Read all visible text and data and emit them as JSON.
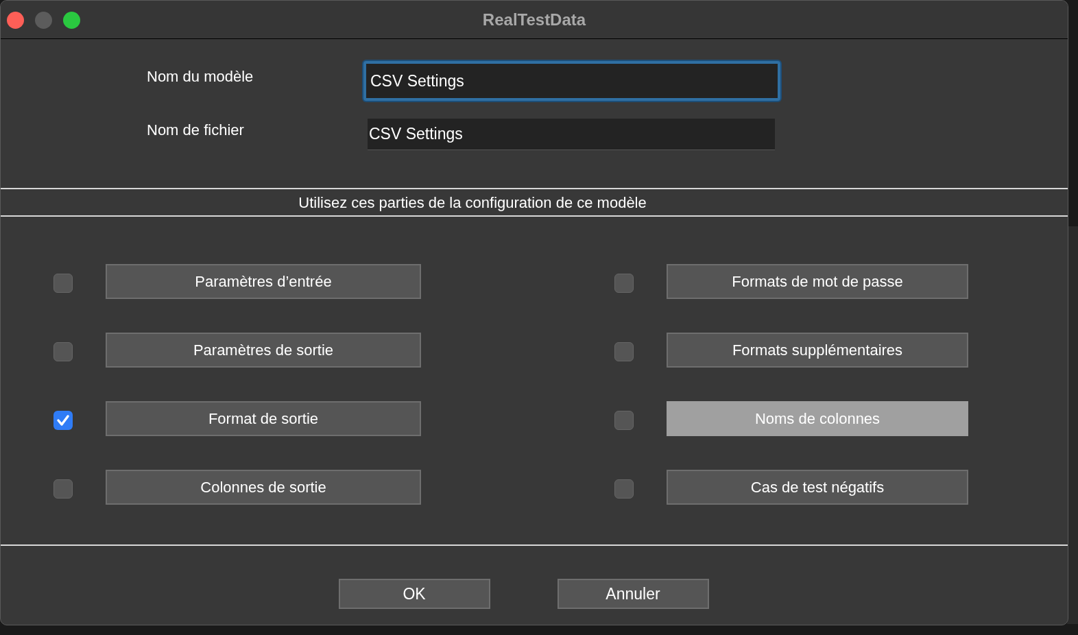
{
  "window": {
    "title": "RealTestData"
  },
  "fields": [
    {
      "label": "Nom du modèle",
      "value": "CSV Settings",
      "focused": true
    },
    {
      "label": "Nom de fichier",
      "value": "CSV Settings",
      "focused": false
    }
  ],
  "section_title": "Utilisez ces parties de la configuration de ce modèle",
  "options": [
    {
      "label": "Paramètres d’entrée",
      "checked": false,
      "selected": false
    },
    {
      "label": "Formats de mot de passe",
      "checked": false,
      "selected": false
    },
    {
      "label": "Paramètres de sortie",
      "checked": false,
      "selected": false
    },
    {
      "label": "Formats supplémentaires",
      "checked": false,
      "selected": false
    },
    {
      "label": "Format de sortie",
      "checked": true,
      "selected": false
    },
    {
      "label": "Noms de colonnes",
      "checked": false,
      "selected": true
    },
    {
      "label": "Colonnes de sortie",
      "checked": false,
      "selected": false
    },
    {
      "label": "Cas de test négatifs",
      "checked": false,
      "selected": false
    }
  ],
  "buttons": [
    "OK",
    "Annuler"
  ]
}
